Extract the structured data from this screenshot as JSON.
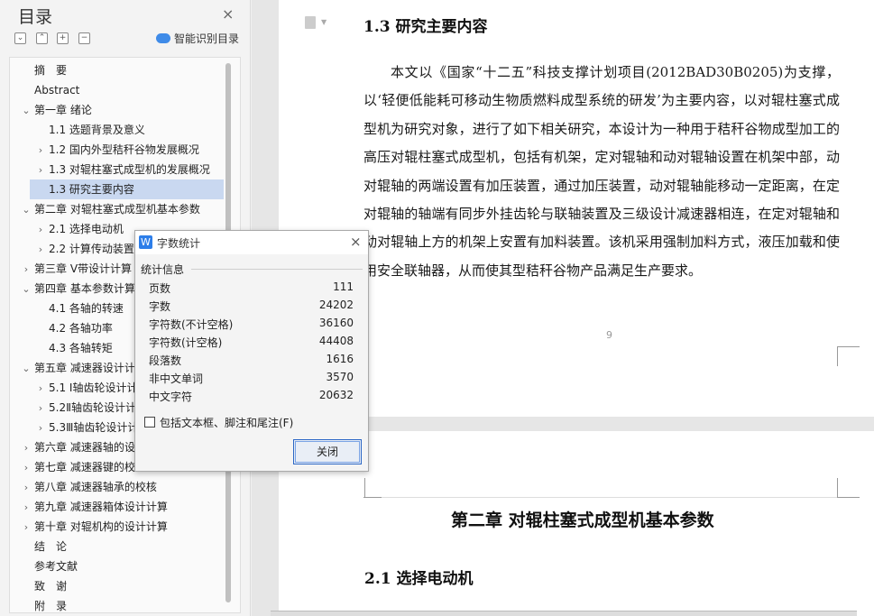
{
  "toc": {
    "title": "目录",
    "close_glyph": "×",
    "tool_buttons": [
      "⌄",
      "⌃",
      "+",
      "−"
    ],
    "smart_label": "智能识别目录",
    "items": [
      {
        "label": "摘　要",
        "level": 1,
        "arrow": ""
      },
      {
        "label": "Abstract",
        "level": 1,
        "arrow": ""
      },
      {
        "label": "第一章  绪论",
        "level": 1,
        "arrow": "⌄"
      },
      {
        "label": "1.1 选题背景及意义",
        "level": 2,
        "arrow": ""
      },
      {
        "label": "1.2 国内外型秸秆谷物发展概况",
        "level": 2,
        "arrow": "›"
      },
      {
        "label": "1.3 对辊柱塞式成型机的发展概况",
        "level": 2,
        "arrow": "›"
      },
      {
        "label": "1.3 研究主要内容",
        "level": 2,
        "arrow": "",
        "selected": true
      },
      {
        "label": "第二章  对辊柱塞式成型机基本参数",
        "level": 1,
        "arrow": "⌄"
      },
      {
        "label": "2.1 选择电动机",
        "level": 2,
        "arrow": "›"
      },
      {
        "label": "2.2 计算传动装置的",
        "level": 2,
        "arrow": "›"
      },
      {
        "label": "第三章  V带设计计算",
        "level": 1,
        "arrow": "›"
      },
      {
        "label": "第四章  基本参数计算",
        "level": 1,
        "arrow": "⌄"
      },
      {
        "label": "4.1 各轴的转速",
        "level": 2,
        "arrow": ""
      },
      {
        "label": "4.2 各轴功率",
        "level": 2,
        "arrow": ""
      },
      {
        "label": "4.3 各轴转矩",
        "level": 2,
        "arrow": ""
      },
      {
        "label": "第五章  减速器设计计",
        "level": 1,
        "arrow": "⌄"
      },
      {
        "label": "5.1 Ⅰ轴齿轮设计计",
        "level": 2,
        "arrow": "›"
      },
      {
        "label": "5.2Ⅱ轴齿轮设计计",
        "level": 2,
        "arrow": "›"
      },
      {
        "label": "5.3Ⅲ轴齿轮设计计",
        "level": 2,
        "arrow": "›"
      },
      {
        "label": "第六章  减速器轴的设",
        "level": 1,
        "arrow": "›"
      },
      {
        "label": "第七章  减速器键的校",
        "level": 1,
        "arrow": "›"
      },
      {
        "label": "第八章  减速器轴承的校核",
        "level": 1,
        "arrow": "›"
      },
      {
        "label": "第九章  减速器箱体设计计算",
        "level": 1,
        "arrow": "›"
      },
      {
        "label": "第十章  对辊机构的设计计算",
        "level": 1,
        "arrow": "›"
      },
      {
        "label": "结　论",
        "level": 1,
        "arrow": ""
      },
      {
        "label": "参考文献",
        "level": 1,
        "arrow": ""
      },
      {
        "label": "致　谢",
        "level": 1,
        "arrow": ""
      },
      {
        "label": "附　录",
        "level": 1,
        "arrow": ""
      }
    ]
  },
  "document": {
    "section_heading": "1.3 研究主要内容",
    "paragraph": "本文以《国家“十二五”科技支撑计划项目(2012BAD30B0205)为支撑，以‘轻便低能耗可移动生物质燃料成型系统的研发’为主要内容，以对辊柱塞式成型机为研究对象，进行了如下相关研究，本设计为一种用于秸秆谷物成型加工的高压对辊柱塞式成型机，包括有机架，定对辊轴和动对辊轴设置在机架中部，动对辊轴的两端设置有加压装置，通过加压装置，动对辊轴能移动一定距离，在定对辊轴的轴端有同步外挂齿轮与联轴装置及三级设计减速器相连，在定对辊轴和动对辊轴上方的机架上安置有加料装置。该机采用强制加料方式，液压加载和使用安全联轴器，从而使其型秸秆谷物产品满足生产要求。",
    "page_number": "9",
    "chapter_title": "第二章  对辊柱塞式成型机基本参数",
    "next_heading": "2.1 选择电动机"
  },
  "dialog": {
    "app_icon": "W",
    "title": "字数统计",
    "close_glyph": "×",
    "section": "统计信息",
    "stats": [
      {
        "label": "页数",
        "value": "111"
      },
      {
        "label": "字数",
        "value": "24202"
      },
      {
        "label": "字符数(不计空格)",
        "value": "36160"
      },
      {
        "label": "字符数(计空格)",
        "value": "44408"
      },
      {
        "label": "段落数",
        "value": "1616"
      },
      {
        "label": "非中文单词",
        "value": "3570"
      },
      {
        "label": "中文字符",
        "value": "20632"
      }
    ],
    "checkbox_label": "包括文本框、脚注和尾注(F)",
    "checkbox_checked": false,
    "close_button": "关闭"
  }
}
